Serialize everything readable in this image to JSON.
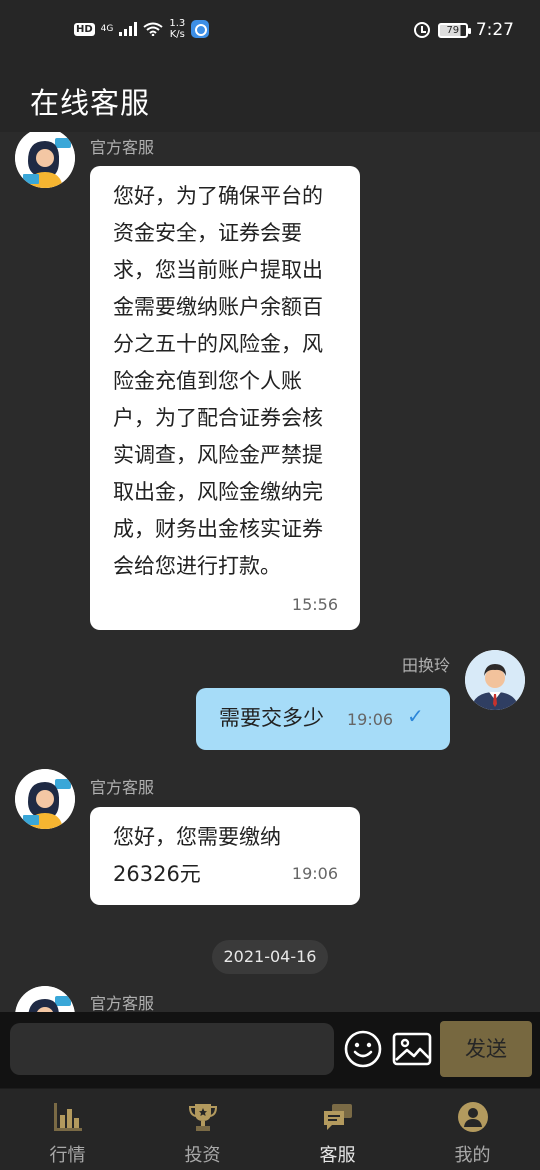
{
  "status_bar": {
    "hd": "HD",
    "network": "4G",
    "speed_value": "1.3",
    "speed_unit": "K/s",
    "battery": "79",
    "time": "7:27"
  },
  "header": {
    "title": "在线客服"
  },
  "messages": [
    {
      "sender": "官方客服",
      "text": "您好，为了确保平台的资金安全，证券会要求，您当前账户提取出金需要缴纳账户余额百分之五十的风险金，风险金充值到您个人账户，为了配合证券会核实调查，风险金严禁提取出金，风险金缴纳完成，财务出金核实证券会给您进行打款。",
      "time": "15:56"
    },
    {
      "sender": "田换玲",
      "text": "需要交多少",
      "time": "19:06",
      "status_icon": "check-icon"
    },
    {
      "sender": "官方客服",
      "text": "您好，您需要缴纳26326元",
      "time": "19:06"
    }
  ],
  "date_divider": "2021-04-16",
  "partial_message": {
    "sender": "官方客服"
  },
  "input": {
    "placeholder": "",
    "send_label": "发送"
  },
  "nav": [
    {
      "label": "行情",
      "icon": "bar-chart-icon"
    },
    {
      "label": "投资",
      "icon": "trophy-icon"
    },
    {
      "label": "客服",
      "icon": "chat-bubbles-icon",
      "active": true
    },
    {
      "label": "我的",
      "icon": "user-icon"
    }
  ],
  "colors": {
    "background": "#2b2b2b",
    "bar": "#262626",
    "own_bubble": "#a6dcf8",
    "send_button": "#776840",
    "check": "#2c86d9"
  }
}
